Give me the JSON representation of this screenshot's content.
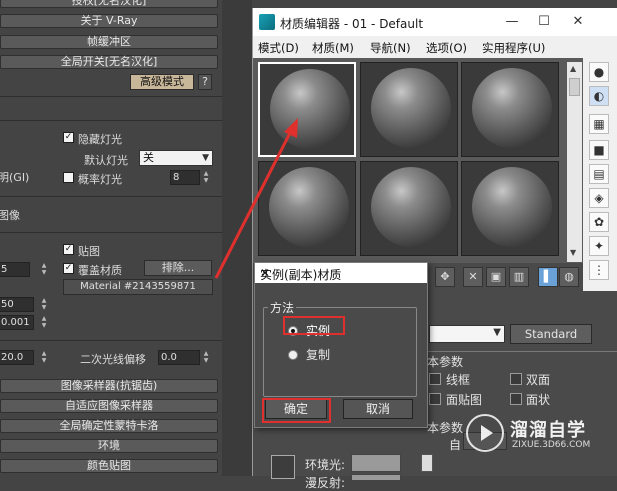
{
  "vray_panel": {
    "rollouts_top": [
      "授权[无名汉化]",
      "关于 V-Ray",
      "帧缓冲区",
      "全局开关[无名汉化]"
    ],
    "advanced_mode_label": "高级模式",
    "help_label": "?",
    "hidden_lights_label": "隐藏灯光",
    "default_lights_label": "默认灯光",
    "default_lights_value": "关",
    "gi_label_partial": "明(GI)",
    "probabilistic_lights_label": "概率灯光",
    "probabilistic_lights_value": "8",
    "image_partial_label": "图像",
    "maps_label": "贴图",
    "override_material_label": "覆盖材质",
    "exclude_label": "排除...",
    "spinner_partial_value": "5",
    "override_material_value": "Material #2143559871",
    "value_50": "50",
    "value_0001": "0.001",
    "value_200": "20.0",
    "secondary_ray_bias_label": "二次光线偏移",
    "secondary_ray_bias_value": "0.0",
    "rollouts_bottom": [
      "图像采样器(抗锯齿)",
      "自适应图像采样器",
      "全局确定性蒙特卡洛",
      "环境",
      "颜色贴图"
    ]
  },
  "material_editor": {
    "title": "材质编辑器 - 01 - Default",
    "menus": [
      "模式(D)",
      "材质(M)",
      "导航(N)",
      "选项(O)",
      "实用程序(U)"
    ],
    "slot_count": 6,
    "selected_slot": 0,
    "side_tools": [
      "sample-type-icon",
      "backlight-icon",
      "background-icon",
      "sample-uv-icon",
      "video-color-icon",
      "make-preview-icon",
      "options-icon",
      "select-by-material-icon",
      "material-map-navigator-icon"
    ],
    "bottom_tools": [
      "get-material-icon",
      "put-to-scene-icon",
      "assign-to-selection-icon",
      "reset-map-icon",
      "copy-material-icon",
      "make-unique-icon",
      "put-to-library-icon",
      "material-id-icon",
      "show-in-viewport-icon",
      "show-end-result-icon"
    ],
    "material_type_label": "Standard",
    "basic_params_label": "本参数",
    "wire_label": "线框",
    "two_sided_label": "双面",
    "face_map_label": "面贴图",
    "faceted_label": "面状",
    "basic_params_label2": "本参数",
    "self_partial_label": "自",
    "ambient_label": "环境光:",
    "diffuse_label_partial": "漫反射:"
  },
  "dialog": {
    "title": "实例(副本)材质",
    "close": "✕",
    "group_title": "方法",
    "option_instance": "实例",
    "option_copy": "复制",
    "selected_option": "instance",
    "ok_label": "确定",
    "cancel_label": "取消"
  },
  "watermark": {
    "brand": "溜溜自学",
    "url": "ZIXUE.3D66.COM"
  },
  "colors": {
    "annotation_red": "#e0302e",
    "accent_blue": "#6aa2d8"
  }
}
